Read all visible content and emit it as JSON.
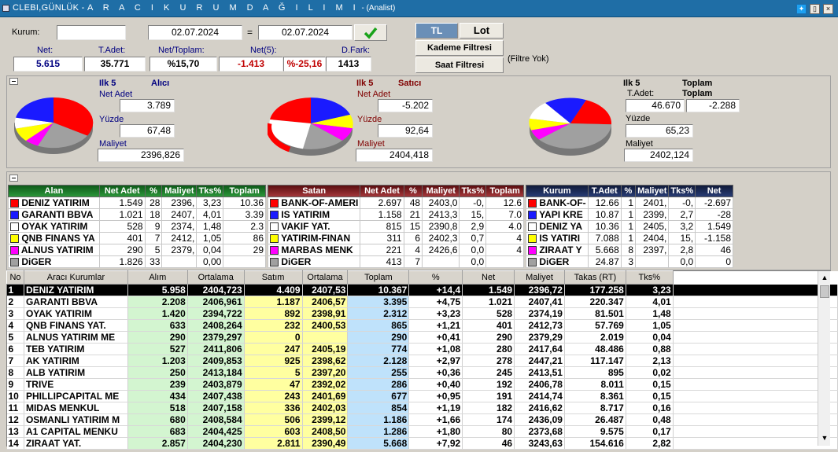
{
  "window": {
    "title_a": "CLEBI,GÜNLÜK - ",
    "title_b": "A R A C I   K U R U M   D A Ğ I L I M I",
    "title_c": " - (Analist)"
  },
  "filters": {
    "kurum_label": "Kurum:",
    "kurum_value": "",
    "date_from": "02.07.2024",
    "eq": "=",
    "date_to": "02.07.2024"
  },
  "toggles": {
    "tl": "TL",
    "lot": "Lot",
    "kademe": "Kademe Filtresi",
    "saat": "Saat Filtresi",
    "filtre_yok": "(Filtre Yok)"
  },
  "stats": {
    "labels": {
      "net": "Net:",
      "tadet": "T.Adet:",
      "net_toplam": "Net/Toplam:",
      "net5": "Net(5):",
      "dfark": "D.Fark:"
    },
    "net": "5.615",
    "tadet": "35.771",
    "net_toplam": "%15,70",
    "net5": "-1.413",
    "net5_pct": "%-25,16",
    "dfark": "1413"
  },
  "pies": {
    "alici": {
      "title": "Ilk 5",
      "sub": "Alıcı",
      "net_adet_label": "Net Adet",
      "net_adet": "3.789",
      "yuzde_label": "Yüzde",
      "yuzde": "67,48",
      "maliyet_label": "Maliyet",
      "maliyet": "2396,826"
    },
    "satici": {
      "title": "Ilk 5",
      "sub": "Satıcı",
      "net_adet_label": "Net Adet",
      "net_adet": "-5.202",
      "yuzde_label": "Yüzde",
      "yuzde": "92,64",
      "maliyet_label": "Maliyet",
      "maliyet": "2404,418"
    },
    "toplam": {
      "title": "Ilk 5",
      "sub": "Toplam",
      "tadet_label": "T.Adet:",
      "toplam_label": "Toplam",
      "tadet": "46.670",
      "toplam": "-2.288",
      "yuzde_label": "Yüzde",
      "yuzde": "65,23",
      "maliyet_label": "Maliyet",
      "maliyet": "2402,124"
    }
  },
  "colors": {
    "red": "#ff0000",
    "blue": "#1a1aff",
    "white": "#ffffff",
    "yellow": "#ffff00",
    "magenta": "#ff00ff",
    "gray": "#a0a0a0"
  },
  "alan": {
    "headers": [
      "Alan",
      "Net Adet",
      "%",
      "Maliyet",
      "Tks%",
      "Toplam"
    ],
    "rows": [
      [
        "DENIZ YATIRIM",
        "1.549",
        "28",
        "2396,",
        "3,23",
        "10.36"
      ],
      [
        "GARANTI BBVA",
        "1.021",
        "18",
        "2407,",
        "4,01",
        "3.39"
      ],
      [
        "OYAK YATIRIM",
        "528",
        "9",
        "2374,",
        "1,48",
        "2.3"
      ],
      [
        "QNB FINANS YA",
        "401",
        "7",
        "2412,",
        "1,05",
        "86"
      ],
      [
        "ALNUS YATIRIM",
        "290",
        "5",
        "2379,",
        "0,04",
        "29"
      ],
      [
        "DiGER",
        "1.826",
        "33",
        "",
        "0,00",
        ""
      ]
    ]
  },
  "satan": {
    "headers": [
      "Satan",
      "Net Adet",
      "%",
      "Maliyet",
      "Tks%",
      "Toplam"
    ],
    "rows": [
      [
        "BANK-OF-AMERI",
        "2.697",
        "48",
        "2403,0",
        "-0,",
        "12.6"
      ],
      [
        "IS YATIRIM",
        "1.158",
        "21",
        "2413,3",
        "15,",
        "7.0"
      ],
      [
        "VAKIF YAT.",
        "815",
        "15",
        "2390,8",
        "2,9",
        "4.0"
      ],
      [
        "YATIRIM-FINAN",
        "311",
        "6",
        "2402,3",
        "0,7",
        "4"
      ],
      [
        "MARBAS MENK",
        "221",
        "4",
        "2426,6",
        "0,0",
        "4"
      ],
      [
        "DiGER",
        "413",
        "7",
        "",
        "0,0",
        ""
      ]
    ]
  },
  "kurum": {
    "headers": [
      "Kurum",
      "T.Adet",
      "%",
      "Maliyet",
      "Tks%",
      "Net"
    ],
    "rows": [
      [
        "BANK-OF-",
        "12.66",
        "1",
        "2401,",
        "-0,",
        "-2.697"
      ],
      [
        "YAPI KRE",
        "10.87",
        "1",
        "2399,",
        "2,7",
        "-28"
      ],
      [
        "DENIZ YA",
        "10.36",
        "1",
        "2405,",
        "3,2",
        "1.549"
      ],
      [
        "IS YATIRI",
        "7.088",
        "1",
        "2404,",
        "15,",
        "-1.158"
      ],
      [
        "ZIRAAT Y",
        "5.668",
        "8",
        "2397,",
        "2,8",
        "46"
      ],
      [
        "DiGER",
        "24.87",
        "3",
        "",
        "0,0",
        "0"
      ]
    ]
  },
  "grid": {
    "headers": [
      "No",
      "Aracı Kurumlar",
      "Alım",
      "Ortalama",
      "Satım",
      "Ortalama",
      "Toplam",
      "%",
      "Net",
      "Maliyet",
      "Takas (RT)",
      "Tks%"
    ],
    "rows": [
      [
        "1",
        "DENIZ YATIRIM",
        "5.958",
        "2404,723",
        "4.409",
        "2407,53",
        "10.367",
        "+14,4",
        "1.549",
        "2396,72",
        "177.258",
        "3,23"
      ],
      [
        "2",
        "GARANTI BBVA",
        "2.208",
        "2406,961",
        "1.187",
        "2406,57",
        "3.395",
        "+4,75",
        "1.021",
        "2407,41",
        "220.347",
        "4,01"
      ],
      [
        "3",
        "OYAK YATIRIM",
        "1.420",
        "2394,722",
        "892",
        "2398,91",
        "2.312",
        "+3,23",
        "528",
        "2374,19",
        "81.501",
        "1,48"
      ],
      [
        "4",
        "QNB FINANS YAT.",
        "633",
        "2408,264",
        "232",
        "2400,53",
        "865",
        "+1,21",
        "401",
        "2412,73",
        "57.769",
        "1,05"
      ],
      [
        "5",
        "ALNUS YATIRIM ME",
        "290",
        "2379,297",
        "0",
        "",
        "290",
        "+0,41",
        "290",
        "2379,29",
        "2.019",
        "0,04"
      ],
      [
        "6",
        "TEB YATIRIM",
        "527",
        "2411,806",
        "247",
        "2405,19",
        "774",
        "+1,08",
        "280",
        "2417,64",
        "48.486",
        "0,88"
      ],
      [
        "7",
        "AK YATIRIM",
        "1.203",
        "2409,853",
        "925",
        "2398,62",
        "2.128",
        "+2,97",
        "278",
        "2447,21",
        "117.147",
        "2,13"
      ],
      [
        "8",
        "ALB YATIRIM",
        "250",
        "2413,184",
        "5",
        "2397,20",
        "255",
        "+0,36",
        "245",
        "2413,51",
        "895",
        "0,02"
      ],
      [
        "9",
        "TRIVE",
        "239",
        "2403,879",
        "47",
        "2392,02",
        "286",
        "+0,40",
        "192",
        "2406,78",
        "8.011",
        "0,15"
      ],
      [
        "10",
        "PHILLIPCAPITAL ME",
        "434",
        "2407,438",
        "243",
        "2401,69",
        "677",
        "+0,95",
        "191",
        "2414,74",
        "8.361",
        "0,15"
      ],
      [
        "11",
        "MIDAS MENKUL",
        "518",
        "2407,158",
        "336",
        "2402,03",
        "854",
        "+1,19",
        "182",
        "2416,62",
        "8.717",
        "0,16"
      ],
      [
        "12",
        "OSMANLI YATIRIM M",
        "680",
        "2408,584",
        "506",
        "2399,12",
        "1.186",
        "+1,66",
        "174",
        "2436,09",
        "26.487",
        "0,48"
      ],
      [
        "13",
        "A1 CAPITAL MENKU",
        "683",
        "2404,425",
        "603",
        "2408,50",
        "1.286",
        "+1,80",
        "80",
        "2373,68",
        "9.575",
        "0,17"
      ],
      [
        "14",
        "ZIRAAT YAT.",
        "2.857",
        "2404,230",
        "2.811",
        "2390,49",
        "5.668",
        "+7,92",
        "46",
        "3243,63",
        "154.616",
        "2,82"
      ]
    ]
  }
}
